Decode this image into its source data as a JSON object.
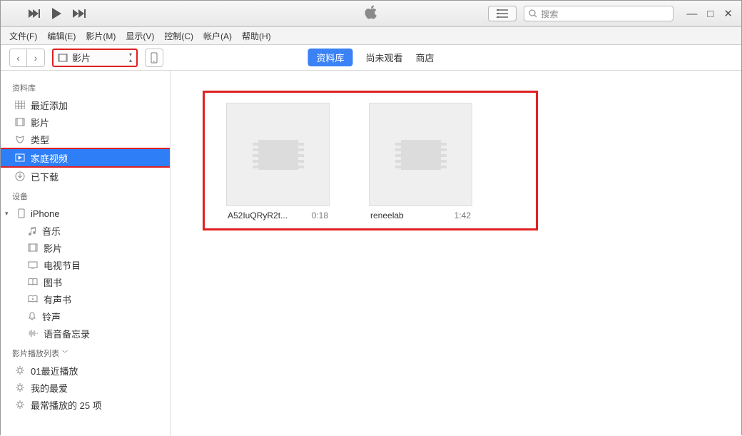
{
  "titlebar": {
    "search_placeholder": "搜索"
  },
  "menubar": {
    "file": "文件(F)",
    "edit": "编辑(E)",
    "movies": "影片(M)",
    "view": "显示(V)",
    "control": "控制(C)",
    "account": "帐户(A)",
    "help": "帮助(H)"
  },
  "toolbar": {
    "category_label": "影片",
    "tabs": {
      "library": "资料库",
      "unwatched": "尚未观看",
      "store": "商店"
    }
  },
  "sidebar": {
    "section_library": "资料库",
    "library_items": [
      {
        "icon": "grid",
        "label": "最近添加"
      },
      {
        "icon": "film",
        "label": "影片"
      },
      {
        "icon": "mask",
        "label": "类型"
      },
      {
        "icon": "home",
        "label": "家庭视频",
        "selected": true
      },
      {
        "icon": "download",
        "label": "已下载"
      }
    ],
    "section_devices": "设备",
    "device_name": "iPhone",
    "device_items": [
      {
        "icon": "music",
        "label": "音乐"
      },
      {
        "icon": "film",
        "label": "影片"
      },
      {
        "icon": "tv",
        "label": "电视节目"
      },
      {
        "icon": "book",
        "label": "图书"
      },
      {
        "icon": "audio",
        "label": "有声书"
      },
      {
        "icon": "bell",
        "label": "铃声"
      },
      {
        "icon": "voice",
        "label": "语音备忘录"
      }
    ],
    "section_playlists": "影片播放列表",
    "playlists": [
      {
        "label": "01最近播放"
      },
      {
        "label": "我的最爱"
      },
      {
        "label": "最常播放的 25 项"
      }
    ]
  },
  "videos": [
    {
      "name": "A52IuQRyR2t...",
      "duration": "0:18"
    },
    {
      "name": "reneelab",
      "duration": "1:42"
    }
  ]
}
